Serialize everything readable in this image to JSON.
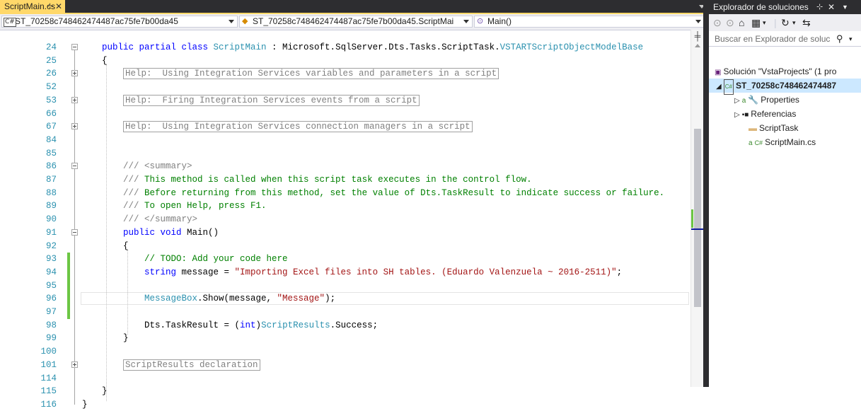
{
  "editor": {
    "tab": {
      "title": "ScriptMain.cs",
      "pin": "⊹",
      "close": "✕"
    },
    "nav": {
      "project": "ST_70258c748462474487ac75fe7b00da45",
      "project_icon": "C#",
      "class": "ST_70258c748462474487ac75fe7b00da45.ScriptMai",
      "member": "Main()"
    },
    "lines": [
      {
        "n": "24",
        "segs": [
          [
            "kw",
            "public partial class "
          ],
          [
            "ty",
            "ScriptMain"
          ],
          [
            "",
            " : Microsoft.SqlServer.Dts.Tasks.ScriptTask."
          ],
          [
            "ty",
            "VSTARTScriptObjectModelBase"
          ]
        ],
        "indent": 0
      },
      {
        "n": "25",
        "segs": [
          [
            "",
            "{"
          ]
        ],
        "indent": 0
      },
      {
        "n": "26",
        "segs": [
          [
            "region",
            "Help:  Using Integration Services variables and parameters in a script"
          ]
        ],
        "indent": 4
      },
      {
        "n": "52",
        "segs": [],
        "indent": 0
      },
      {
        "n": "53",
        "segs": [
          [
            "region",
            "Help:  Firing Integration Services events from a script"
          ]
        ],
        "indent": 4
      },
      {
        "n": "66",
        "segs": [],
        "indent": 0
      },
      {
        "n": "67",
        "segs": [
          [
            "region",
            "Help:  Using Integration Services connection managers in a script"
          ]
        ],
        "indent": 4
      },
      {
        "n": "84",
        "segs": [],
        "indent": 0
      },
      {
        "n": "85",
        "segs": [],
        "indent": 0
      },
      {
        "n": "86",
        "segs": [
          [
            "cmg",
            "/// <summary>"
          ]
        ],
        "indent": 4
      },
      {
        "n": "87",
        "segs": [
          [
            "cmg",
            "/// "
          ],
          [
            "cm",
            "This method is called when this script task executes in the control flow."
          ]
        ],
        "indent": 4
      },
      {
        "n": "88",
        "segs": [
          [
            "cmg",
            "/// "
          ],
          [
            "cm",
            "Before returning from this method, set the value of Dts.TaskResult to indicate success or failure."
          ]
        ],
        "indent": 4
      },
      {
        "n": "89",
        "segs": [
          [
            "cmg",
            "/// "
          ],
          [
            "cm",
            "To open Help, press F1."
          ]
        ],
        "indent": 4
      },
      {
        "n": "90",
        "segs": [
          [
            "cmg",
            "/// </summary>"
          ]
        ],
        "indent": 4
      },
      {
        "n": "91",
        "segs": [
          [
            "kw",
            "public void "
          ],
          [
            "",
            "Main()"
          ]
        ],
        "indent": 4
      },
      {
        "n": "92",
        "segs": [
          [
            "",
            "{"
          ]
        ],
        "indent": 4
      },
      {
        "n": "93",
        "segs": [
          [
            "cm",
            "// TODO: Add your code here"
          ]
        ],
        "indent": 8
      },
      {
        "n": "94",
        "segs": [
          [
            "kw",
            "string "
          ],
          [
            "",
            "message = "
          ],
          [
            "str",
            "\"Importing Excel files into SH tables. (Eduardo Valenzuela ~ 2016-2511)\""
          ],
          [
            "",
            ";"
          ]
        ],
        "indent": 8
      },
      {
        "n": "95",
        "segs": [],
        "indent": 0
      },
      {
        "n": "96",
        "segs": [
          [
            "ty",
            "MessageBox"
          ],
          [
            "",
            ".Show(message, "
          ],
          [
            "str",
            "\"Message\""
          ],
          [
            "",
            ");"
          ]
        ],
        "indent": 8
      },
      {
        "n": "97",
        "segs": [],
        "indent": 0
      },
      {
        "n": "98",
        "segs": [
          [
            "",
            "Dts.TaskResult = ("
          ],
          [
            "kw",
            "int"
          ],
          [
            "",
            ")"
          ],
          [
            "ty",
            "ScriptResults"
          ],
          [
            "",
            ".Success;"
          ]
        ],
        "indent": 8
      },
      {
        "n": "99",
        "segs": [
          [
            "",
            "}"
          ]
        ],
        "indent": 4
      },
      {
        "n": "100",
        "segs": [],
        "indent": 0
      },
      {
        "n": "101",
        "segs": [
          [
            "region",
            "ScriptResults declaration"
          ]
        ],
        "indent": 4
      },
      {
        "n": "114",
        "segs": [],
        "indent": 0
      },
      {
        "n": "115",
        "segs": [
          [
            "",
            "}"
          ]
        ],
        "indent": 0
      },
      {
        "n": "116",
        "segs": [
          [
            "",
            "}"
          ]
        ],
        "indent": -4
      }
    ]
  },
  "solution_explorer": {
    "title": "Explorador de soluciones",
    "search_placeholder": "Buscar en Explorador de soluc",
    "items": [
      {
        "label": "Solución \"VstaProjects\" (1 pro",
        "icon": "solution-icon"
      },
      {
        "label": "ST_70258c748462474487",
        "icon": "csharp-project-icon",
        "selected": true
      },
      {
        "label": "Properties",
        "icon": "wrench-icon"
      },
      {
        "label": "Referencias",
        "icon": "references-icon"
      },
      {
        "label": "ScriptTask",
        "icon": "folder-icon"
      },
      {
        "label": "ScriptMain.cs",
        "icon": "csharp-file-icon"
      }
    ]
  },
  "colors": {
    "keyword": "#0000ff",
    "type": "#2b91af",
    "string": "#a31515",
    "comment": "#008000",
    "tab_active": "#ffd86a",
    "chrome_dark": "#2d2d30"
  }
}
